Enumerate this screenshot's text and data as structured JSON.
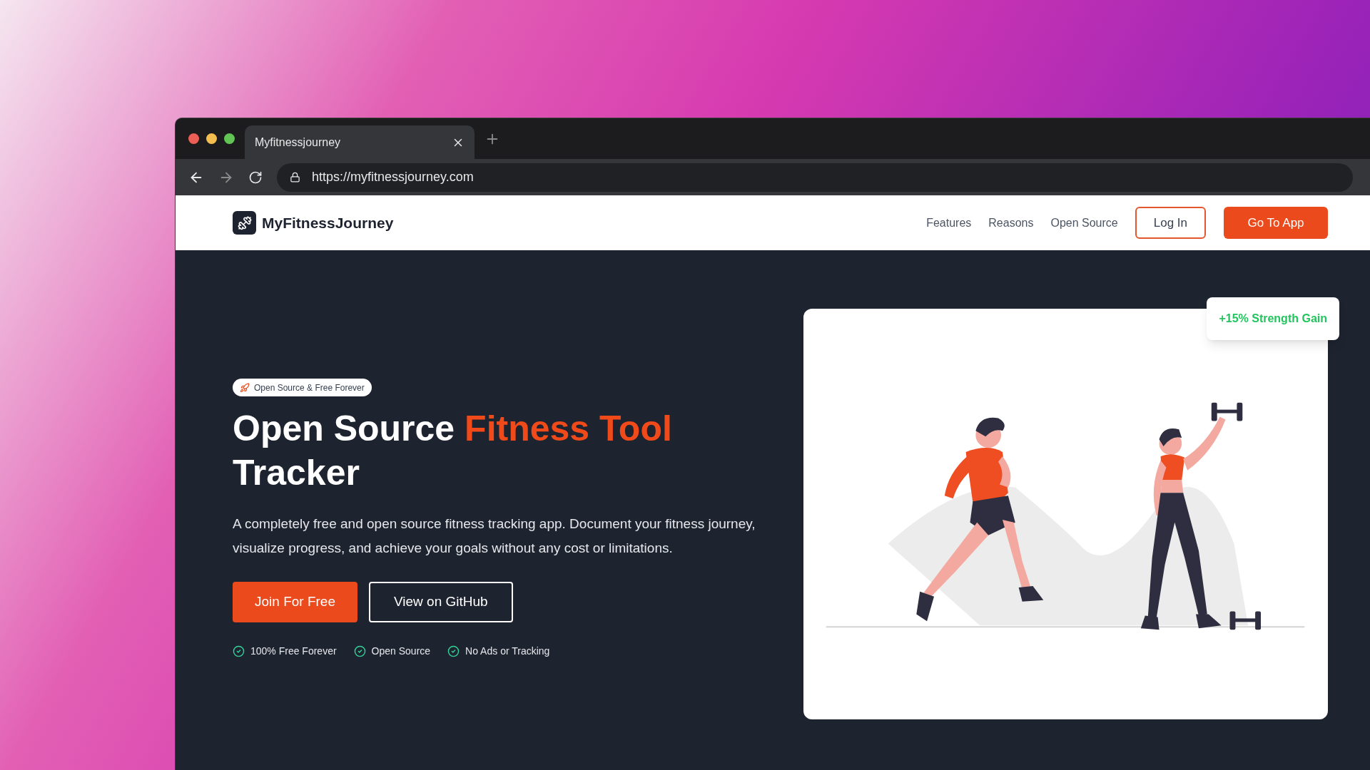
{
  "browser": {
    "tab_title": "Myfitnessjourney",
    "url": "https://myfitnessjourney.com"
  },
  "header": {
    "logo_text": "MyFitnessJourney",
    "nav_links": [
      "Features",
      "Reasons",
      "Open Source"
    ],
    "login_button": "Log In",
    "cta_button": "Go To App"
  },
  "hero": {
    "badge": "Open Source & Free Forever",
    "title_parts": [
      {
        "text": "Open Source",
        "highlight": false
      },
      {
        "text": "Fitness Tool",
        "highlight": true
      },
      {
        "text": "Tracker",
        "highlight": false
      }
    ],
    "description": "A completely free and open source fitness tracking app. Document your fitness journey, visualize progress, and achieve your goals without any cost or limitations.",
    "primary_button": "Join For Free",
    "secondary_button": "View on GitHub",
    "checks": [
      "100% Free Forever",
      "Open Source",
      "No Ads or Tracking"
    ]
  },
  "illustration_card": {
    "stat_badge": "+15% Strength Gain"
  }
}
